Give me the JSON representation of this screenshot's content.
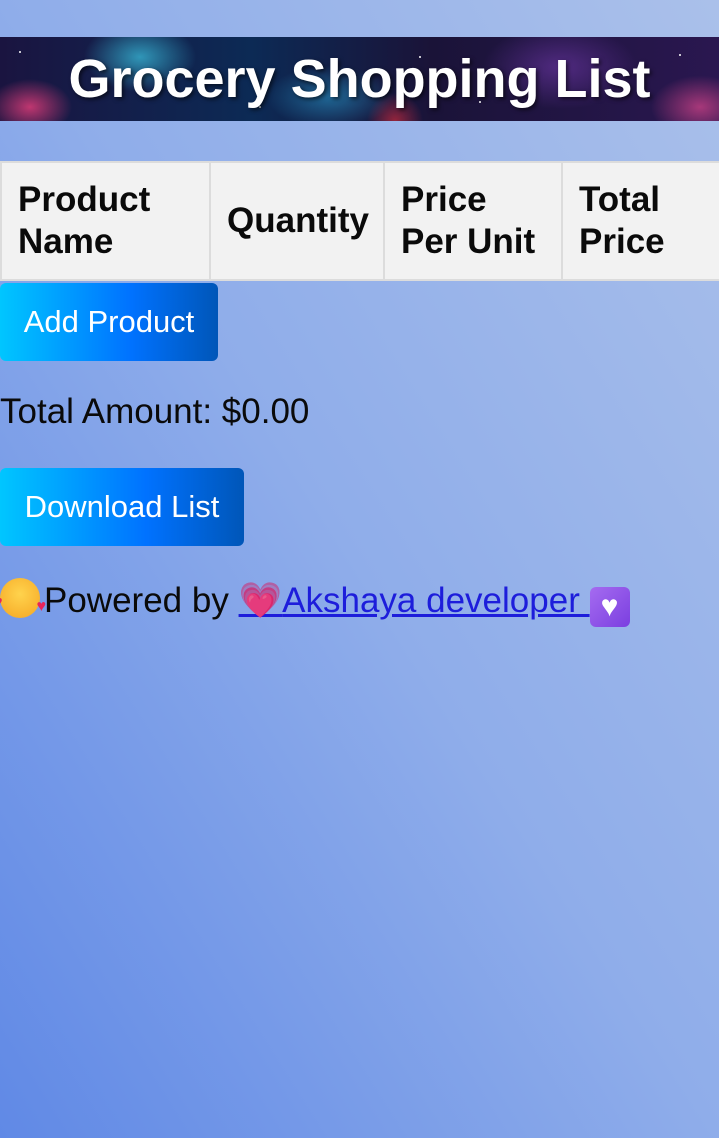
{
  "header": {
    "title": "Grocery Shopping List"
  },
  "table": {
    "headers": [
      "Product Name",
      "Quantity",
      "Price Per Unit",
      "Total Price"
    ]
  },
  "actions": {
    "add_product_label": "Add Product",
    "download_list_label": "Download List"
  },
  "summary": {
    "total_amount_text": "Total Amount: $0.00"
  },
  "footer": {
    "prefix_emoji": "🥰",
    "powered_by_text": "Powered by ",
    "link_leading_emoji": "💗",
    "link_text": "Akshaya developer ",
    "link_trailing_emoji": "🤍"
  },
  "colors": {
    "button_gradient_start": "#00c6ff",
    "button_gradient_end": "#0056b8",
    "link_color": "#1d1ddb",
    "table_header_bg": "#f2f2f2"
  }
}
